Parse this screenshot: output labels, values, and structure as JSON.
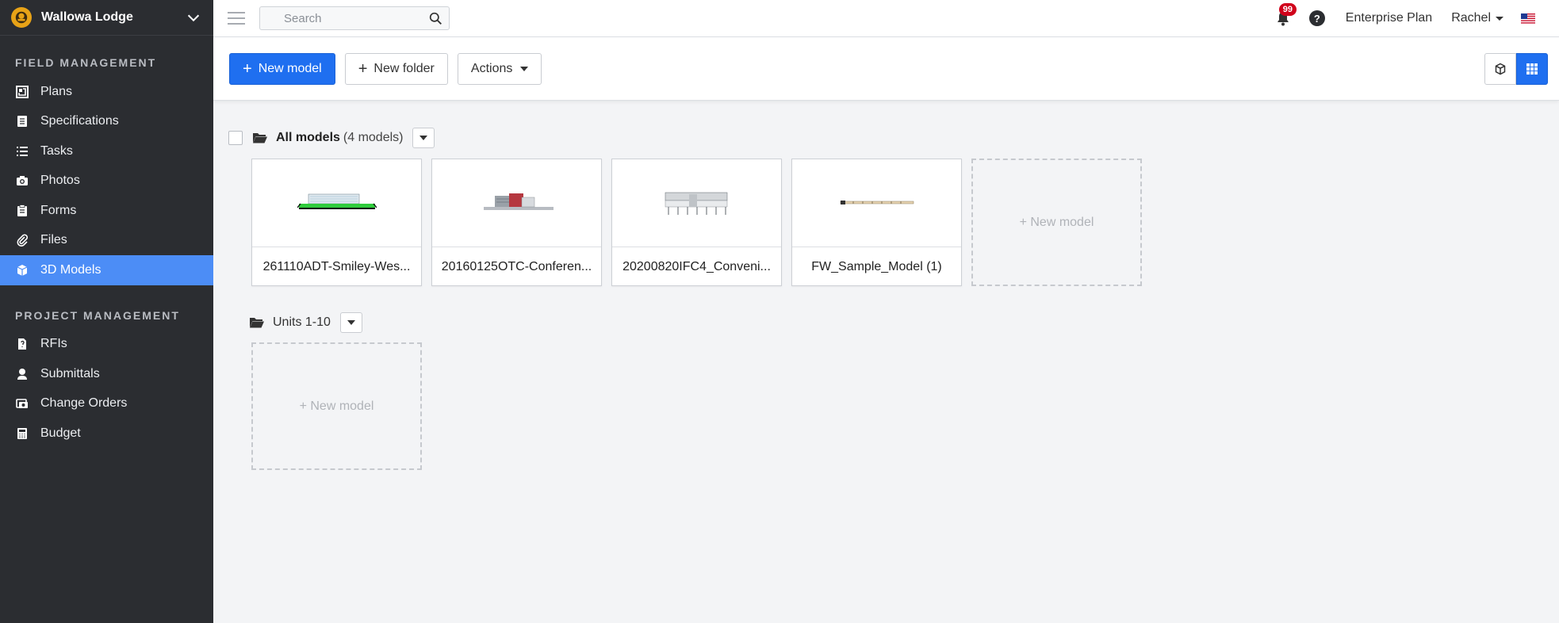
{
  "sidebar": {
    "project_name": "Wallowa Lodge",
    "sections": [
      {
        "title": "FIELD MANAGEMENT",
        "items": [
          {
            "label": "Plans",
            "icon": "plans-icon"
          },
          {
            "label": "Specifications",
            "icon": "specifications-icon"
          },
          {
            "label": "Tasks",
            "icon": "tasks-icon"
          },
          {
            "label": "Photos",
            "icon": "camera-icon"
          },
          {
            "label": "Forms",
            "icon": "forms-icon"
          },
          {
            "label": "Files",
            "icon": "paperclip-icon"
          },
          {
            "label": "3D Models",
            "icon": "cube-icon",
            "active": true
          }
        ]
      },
      {
        "title": "PROJECT MANAGEMENT",
        "items": [
          {
            "label": "RFIs",
            "icon": "rfi-icon"
          },
          {
            "label": "Submittals",
            "icon": "submittals-icon"
          },
          {
            "label": "Change Orders",
            "icon": "change-orders-icon"
          },
          {
            "label": "Budget",
            "icon": "calculator-icon"
          }
        ]
      }
    ]
  },
  "topbar": {
    "search_placeholder": "Search",
    "notification_count": "99",
    "help_label": "?",
    "plan_label": "Enterprise Plan",
    "user_name": "Rachel"
  },
  "toolbar": {
    "new_model_label": "New model",
    "new_folder_label": "New folder",
    "actions_label": "Actions"
  },
  "folders": [
    {
      "name": "All models",
      "count_label": "(4 models)",
      "models": [
        {
          "name": "261110ADT-Smiley-Wes..."
        },
        {
          "name": "20160125OTC-Conferen..."
        },
        {
          "name": "20200820IFC4_Conveni..."
        },
        {
          "name": "FW_Sample_Model (1)"
        }
      ],
      "new_model_label": "+ New model"
    },
    {
      "name": "Units 1-10",
      "count_label": "",
      "models": [],
      "new_model_label": "+ New model"
    }
  ],
  "colors": {
    "sidebar_bg": "#2b2d31",
    "active_item": "#4c8df6",
    "primary_button": "#1f6ff0",
    "badge": "#d0021b"
  }
}
